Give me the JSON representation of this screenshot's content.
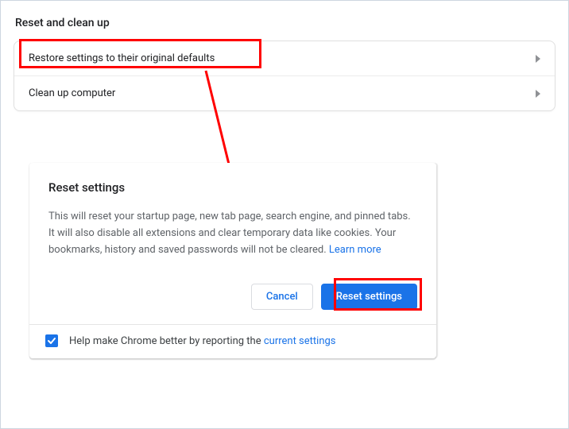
{
  "section": {
    "title": "Reset and clean up",
    "rows": [
      {
        "label": "Restore settings to their original defaults"
      },
      {
        "label": "Clean up computer"
      }
    ]
  },
  "dialog": {
    "title": "Reset settings",
    "body_text": "This will reset your startup page, new tab page, search engine, and pinned tabs. It will also disable all extensions and clear temporary data like cookies. Your bookmarks, history and saved passwords will not be cleared. ",
    "learn_more": "Learn more",
    "cancel_label": "Cancel",
    "reset_label": "Reset settings",
    "footer_prefix": "Help make Chrome better by reporting the ",
    "footer_link": "current settings",
    "checked": true
  },
  "annotations": {
    "highlight_color": "#ff0000",
    "arrow_color": "#ff0000"
  }
}
